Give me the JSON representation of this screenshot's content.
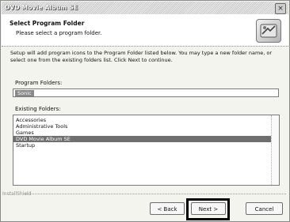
{
  "window": {
    "title": "DVD Movie Album SE",
    "close_glyph": "×"
  },
  "header": {
    "title": "Select Program Folder",
    "subtitle": "Please select a program folder.",
    "logo_icon": "installer-logo-icon"
  },
  "description": "Setup will add program icons to the Program Folder listed below. You may type a new folder name, or select one from the existing folders list. Click Next to continue.",
  "program_folder": {
    "label": "Program Folders:",
    "value": "Sonic"
  },
  "existing": {
    "label": "Existing Folders:",
    "items": [
      "Accessories",
      "Administrative Tools",
      "Games",
      "DVD Movie Album SE",
      "Startup"
    ],
    "selected_index": 3
  },
  "footer": {
    "brand": "InstallShield",
    "back_label": "< Back",
    "next_label": "Next >",
    "cancel_label": "Cancel"
  }
}
